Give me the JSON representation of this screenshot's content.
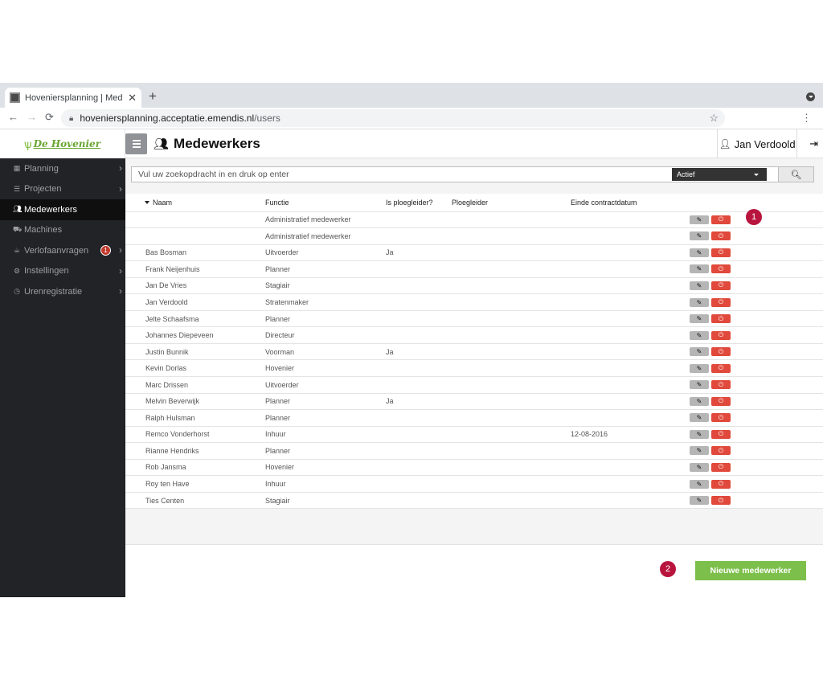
{
  "browser": {
    "tab_title": "Hoveniersplanning | Medewerke",
    "url_host": "hoveniersplanning.acceptatie.emendis.nl",
    "url_path": "/users"
  },
  "logo": {
    "text": "De Hovenier"
  },
  "sidebar": {
    "items": [
      {
        "label": "Planning",
        "icon": "calendar-icon",
        "chevron": true,
        "active": false
      },
      {
        "label": "Projecten",
        "icon": "list-icon",
        "chevron": true,
        "active": false
      },
      {
        "label": "Medewerkers",
        "icon": "users-icon",
        "chevron": false,
        "active": true
      },
      {
        "label": "Machines",
        "icon": "truck-icon",
        "chevron": false,
        "active": false
      },
      {
        "label": "Verlofaanvragen",
        "icon": "coffee-icon",
        "chevron": true,
        "active": false,
        "badge": "1"
      },
      {
        "label": "Instellingen",
        "icon": "cogs-icon",
        "chevron": true,
        "active": false
      },
      {
        "label": "Urenregistratie",
        "icon": "clock-icon",
        "chevron": true,
        "active": false
      }
    ]
  },
  "header": {
    "title": "Medewerkers",
    "user_name": "Jan Verdoold"
  },
  "search": {
    "placeholder": "Vul uw zoekopdracht in en druk op enter",
    "status_selected": "Actief"
  },
  "table": {
    "columns": [
      "Naam",
      "Functie",
      "Is ploegleider?",
      "Ploegleider",
      "Einde contractdatum"
    ],
    "rows": [
      {
        "naam": "",
        "functie": "Administratief medewerker",
        "ploegleider_flag": "",
        "ploegleider": "",
        "einde": ""
      },
      {
        "naam": "",
        "functie": "Administratief medewerker",
        "ploegleider_flag": "",
        "ploegleider": "",
        "einde": ""
      },
      {
        "naam": "Bas Bosman",
        "functie": "Uitvoerder",
        "ploegleider_flag": "Ja",
        "ploegleider": "",
        "einde": ""
      },
      {
        "naam": "Frank Neijenhuis",
        "functie": "Planner",
        "ploegleider_flag": "",
        "ploegleider": "",
        "einde": ""
      },
      {
        "naam": "Jan De Vries",
        "functie": "Stagiair",
        "ploegleider_flag": "",
        "ploegleider": "",
        "einde": ""
      },
      {
        "naam": "Jan Verdoold",
        "functie": "Stratenmaker",
        "ploegleider_flag": "",
        "ploegleider": "",
        "einde": ""
      },
      {
        "naam": "Jelte Schaafsma",
        "functie": "Planner",
        "ploegleider_flag": "",
        "ploegleider": "",
        "einde": ""
      },
      {
        "naam": "Johannes Diepeveen",
        "functie": "Directeur",
        "ploegleider_flag": "",
        "ploegleider": "",
        "einde": ""
      },
      {
        "naam": "Justin Bunnik",
        "functie": "Voorman",
        "ploegleider_flag": "Ja",
        "ploegleider": "",
        "einde": ""
      },
      {
        "naam": "Kevin Dorlas",
        "functie": "Hovenier",
        "ploegleider_flag": "",
        "ploegleider": "",
        "einde": ""
      },
      {
        "naam": "Marc Drissen",
        "functie": "Uitvoerder",
        "ploegleider_flag": "",
        "ploegleider": "",
        "einde": ""
      },
      {
        "naam": "Melvin Beverwijk",
        "functie": "Planner",
        "ploegleider_flag": "Ja",
        "ploegleider": "",
        "einde": ""
      },
      {
        "naam": "Ralph Hulsman",
        "functie": "Planner",
        "ploegleider_flag": "",
        "ploegleider": "",
        "einde": ""
      },
      {
        "naam": "Remco Vonderhorst",
        "functie": "Inhuur",
        "ploegleider_flag": "",
        "ploegleider": "",
        "einde": "12-08-2016"
      },
      {
        "naam": "Rianne Hendriks",
        "functie": "Planner",
        "ploegleider_flag": "",
        "ploegleider": "",
        "einde": ""
      },
      {
        "naam": "Rob Jansma",
        "functie": "Hovenier",
        "ploegleider_flag": "",
        "ploegleider": "",
        "einde": ""
      },
      {
        "naam": "Roy ten Have",
        "functie": "Inhuur",
        "ploegleider_flag": "",
        "ploegleider": "",
        "einde": ""
      },
      {
        "naam": "Ties Centen",
        "functie": "Stagiair",
        "ploegleider_flag": "",
        "ploegleider": "",
        "einde": ""
      }
    ]
  },
  "markers": {
    "one": "1",
    "two": "2"
  },
  "footer": {
    "new_button": "Nieuwe medewerker"
  },
  "colors": {
    "sidebar_bg": "#222326",
    "accent_green": "#7cbf4a",
    "danger_red": "#e0493b",
    "marker": "#b8153e"
  }
}
